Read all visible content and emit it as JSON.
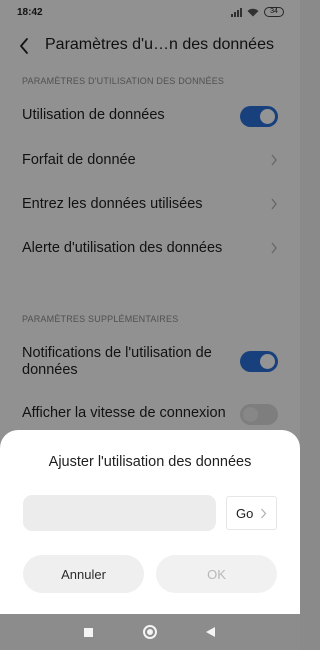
{
  "status_bar": {
    "time": "18:42",
    "battery": "34"
  },
  "header": {
    "title": "Paramètres d'u…n des données"
  },
  "sections": [
    {
      "header": "PARAMÈTRES D'UTILISATION DES DONNÉES"
    },
    {
      "header": "PARAMÈTRES SUPPLÉMENTAIRES"
    }
  ],
  "settings": [
    {
      "label": "Utilisation de données",
      "control": "toggle",
      "on": true
    },
    {
      "label": "Forfait de donnée",
      "control": "chevron"
    },
    {
      "label": "Entrez les données utilisées",
      "control": "chevron"
    },
    {
      "label": "Alerte d'utilisation des données",
      "control": "chevron"
    },
    {
      "label": "Notifications de l'utilisation de données",
      "control": "toggle",
      "on": true
    },
    {
      "label": "Afficher la vitesse de connexion",
      "control": "toggle",
      "on": false
    }
  ],
  "dialog": {
    "title": "Ajuster l'utilisation des données",
    "input_value": "",
    "go_label": "Go",
    "cancel_label": "Annuler",
    "ok_label": "OK",
    "ok_enabled": false
  },
  "colors": {
    "accent": "#2a6fd6",
    "toggle_off": "#d9d9d9"
  }
}
